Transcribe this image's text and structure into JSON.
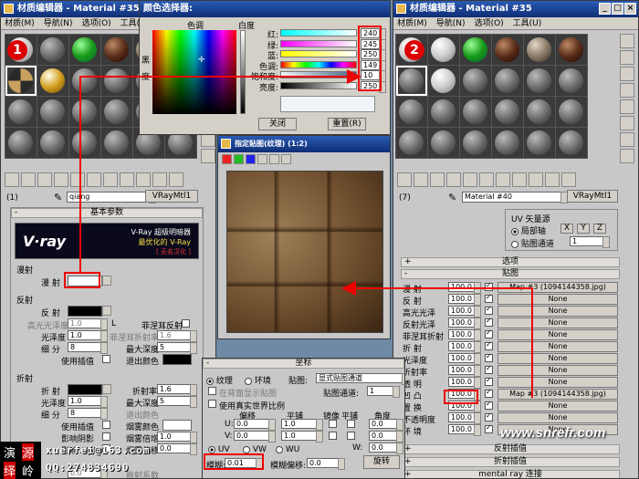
{
  "left_window": {
    "title": "材质编辑器 - Material #35",
    "menu": [
      "材质(M)",
      "导航(N)",
      "选项(O)",
      "工具(U)"
    ],
    "badge": "1",
    "material_name": "qiang",
    "material_type": "VRayMtl1",
    "slot_label": "(1)"
  },
  "right_window": {
    "title": "材质编辑器 - Material #35",
    "menu": [
      "材质(M)",
      "导航(N)",
      "选项(O)",
      "工具(U)"
    ],
    "badge": "2",
    "material_name": "Material #40",
    "material_type": "VRayMtl1",
    "slot_label": "(7)"
  },
  "color_picker": {
    "title": "颜色选择器:",
    "hue_label": "色调",
    "white_label": "白度",
    "black_label": "黑",
    "degree_label": "度",
    "channels": [
      {
        "label": "红:",
        "value": "240"
      },
      {
        "label": "绿:",
        "value": "245"
      },
      {
        "label": "蓝:",
        "value": "250"
      },
      {
        "label": "色调:",
        "value": "149"
      },
      {
        "label": "饱和度:",
        "value": "10"
      },
      {
        "label": "亮度:",
        "value": "250"
      }
    ],
    "close_label": "关闭",
    "reset_label": "重置(R)"
  },
  "texture_view": {
    "title": "指定贴图(纹理) (1:2)"
  },
  "vray_banner": {
    "brand": "V·ray",
    "line1": "V-Ray 超级明暗器",
    "line2": "最优化的 V-Ray",
    "line3": "[ 无名汉化 ]"
  },
  "basic_params": {
    "header": "基本参数",
    "diffuse_group": "漫射",
    "diffuse_label": "漫  射",
    "reflect_group": "反射",
    "reflect_label": "反  射",
    "hilight_gloss": "高光光泽度",
    "hilight_gloss_value": "1.0",
    "L_label": "L",
    "fresnel_label": "菲涅耳反射",
    "refl_gloss": "光泽度",
    "refl_gloss_value": "1.0",
    "fresnel_ior": "菲涅耳折射率",
    "fresnel_ior_value": "1.6",
    "subdivs": "细  分",
    "subdivs_value": "8",
    "max_depth": "最大深度",
    "max_depth_value": "5",
    "use_interp": "使用插值",
    "exit_color": "退出颜色",
    "refract_group": "折射",
    "refract_label": "折  射",
    "ior": "折射率",
    "ior_value": "1.6",
    "r_gloss": "光泽度",
    "r_gloss_value": "1.0",
    "r_max_depth": "最大深度",
    "r_max_depth_value": "5",
    "r_subdivs": "细  分",
    "r_subdivs_value": "8",
    "r_exit_color": "退出颜色",
    "r_use_interp": "使用插值",
    "fog_color": "烟雾颜色",
    "shadow": "影响阴影",
    "fog_mult": "烟雾倍增",
    "fog_mult_value": "1.0",
    "affect_alpha": "影响 Alpha",
    "fog_bias": "烟雾偏移",
    "fog_bias_value": "0.0",
    "scatter": "散射系数",
    "sub_val": "0.0"
  },
  "watermark": {
    "c1": "演",
    "c2": "绎",
    "c3": "源",
    "c4": "岭",
    "email": "xuerfei@163.com",
    "qq": "QQ:274834690",
    "site": "www.snrefr.com"
  },
  "coords": {
    "header": "坐标",
    "texture": "纹理",
    "env": "环境",
    "map_label": "贴图:",
    "map_value": "显式贴图通道",
    "show_back": "在背面显示贴图",
    "channel_label": "贴图通道:",
    "channel_value": "1",
    "real_world": "使用真实世界比例",
    "offset": "偏移",
    "tiling": "平铺",
    "mirror": "镜像",
    "tile": "平铺",
    "angle": "角度",
    "u_label": "U:",
    "v_label": "V:",
    "w_label": "W:",
    "u_offset": "0.0",
    "v_offset": "0.0",
    "u_tile": "1.0",
    "v_tile": "1.0",
    "u_angle": "0.0",
    "v_angle": "0.0",
    "w_angle": "0.0",
    "uv": "UV",
    "vw": "VW",
    "wu": "WU",
    "blur_label": "模糊:",
    "blur_value": "0.01",
    "blur_offset_label": "模糊偏移:",
    "blur_offset_value": "0.0",
    "rotate": "旋转"
  },
  "uv_source": {
    "header": "UV 矢量源",
    "local": "局部轴",
    "x": "X",
    "y": "Y",
    "z": "Z",
    "channel": "贴图通道",
    "channel_value": "1"
  },
  "maps": {
    "options_header": "选项",
    "header": "贴图",
    "rows": [
      {
        "label": "漫  射",
        "amount": "100.0",
        "map": "Map #3 (1094144358.jpg)"
      },
      {
        "label": "反  射",
        "amount": "100.0",
        "map": "None"
      },
      {
        "label": "高光光泽",
        "amount": "100.0",
        "map": "None"
      },
      {
        "label": "反射光泽",
        "amount": "100.0",
        "map": "None"
      },
      {
        "label": "菲涅耳折射",
        "amount": "100.0",
        "map": "None"
      },
      {
        "label": "折  射",
        "amount": "100.0",
        "map": "None"
      },
      {
        "label": "光泽度",
        "amount": "100.0",
        "map": "None"
      },
      {
        "label": "折射率",
        "amount": "100.0",
        "map": "None"
      },
      {
        "label": "透  明",
        "amount": "100.0",
        "map": "None"
      },
      {
        "label": "凹  凸",
        "amount": "100.0",
        "map": "Map #3 (1094144358.jpg)"
      },
      {
        "label": "置  换",
        "amount": "100.0",
        "map": "None"
      },
      {
        "label": "不透明度",
        "amount": "100.0",
        "map": "None"
      },
      {
        "label": "环  境",
        "amount": "100.0",
        "map": "None"
      }
    ],
    "refl_interp": "反射插值",
    "refr_interp": "折射插值",
    "mental_ray": "mental ray 连接"
  }
}
